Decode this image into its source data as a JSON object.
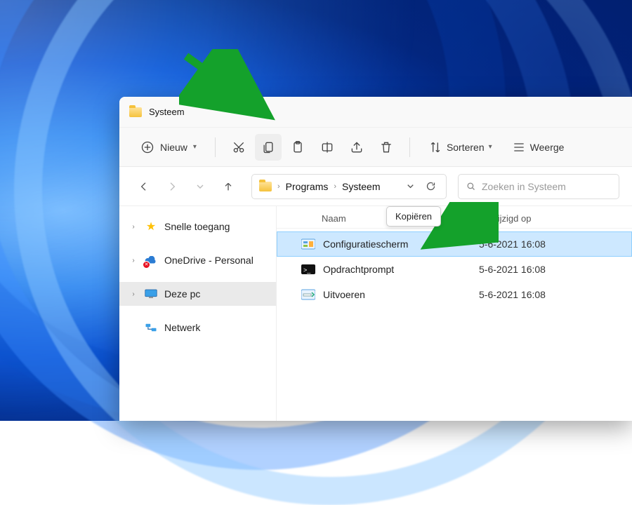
{
  "window": {
    "title": "Systeem"
  },
  "toolbar": {
    "new_label": "Nieuw",
    "sort_label": "Sorteren",
    "view_label": "Weerge",
    "tooltip_copy": "Kopiëren"
  },
  "breadcrumbs": {
    "items": [
      "Programs",
      "Systeem"
    ]
  },
  "search": {
    "placeholder": "Zoeken in Systeem"
  },
  "sidebar": {
    "items": [
      {
        "label": "Snelle toegang",
        "icon": "star",
        "expandable": true
      },
      {
        "label": "OneDrive - Personal",
        "icon": "cloud-error",
        "expandable": true
      },
      {
        "label": "Deze pc",
        "icon": "pc",
        "expandable": true,
        "selected": true
      },
      {
        "label": "Netwerk",
        "icon": "network",
        "expandable": false
      }
    ]
  },
  "columns": {
    "name": "Naam",
    "modified": "Gewijzigd op"
  },
  "files": [
    {
      "name": "Configuratiescherm",
      "modified": "5-6-2021 16:08",
      "icon": "control-panel",
      "selected": true
    },
    {
      "name": "Opdrachtprompt",
      "modified": "5-6-2021 16:08",
      "icon": "cmd"
    },
    {
      "name": "Uitvoeren",
      "modified": "5-6-2021 16:08",
      "icon": "run"
    }
  ],
  "annotation": {
    "arrow_color": "#14a12b"
  }
}
